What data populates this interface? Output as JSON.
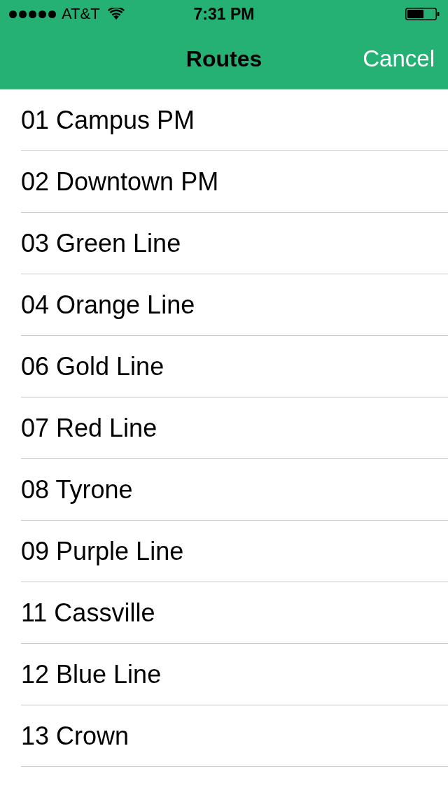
{
  "status_bar": {
    "carrier": "AT&T",
    "time": "7:31 PM"
  },
  "nav_bar": {
    "title": "Routes",
    "cancel_button": "Cancel"
  },
  "routes": [
    "01 Campus PM",
    "02 Downtown PM",
    "03 Green Line",
    "04 Orange Line",
    "06 Gold Line",
    "07 Red Line",
    "08 Tyrone",
    "09 Purple Line",
    "11 Cassville",
    "12 Blue Line",
    "13 Crown"
  ]
}
